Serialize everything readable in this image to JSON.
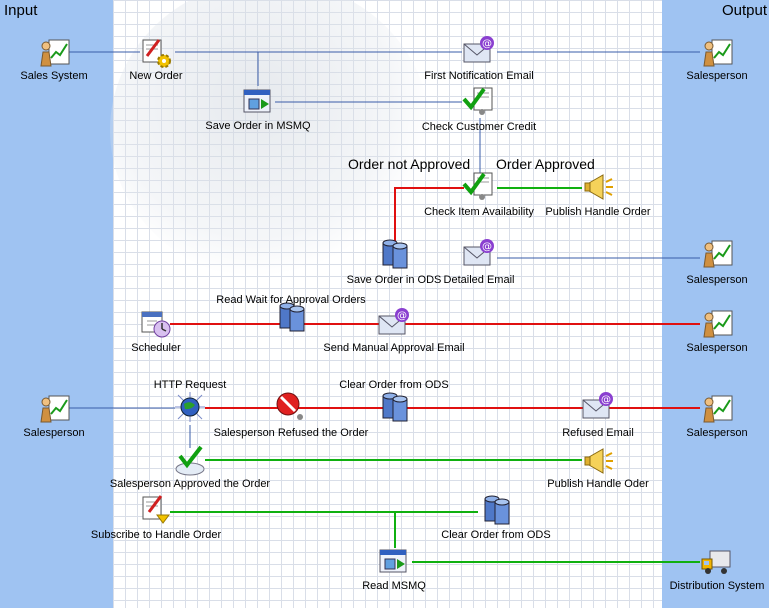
{
  "lanes": {
    "input": "Input",
    "output": "Output"
  },
  "colors": {
    "lane": "#9fc3f2",
    "line": "#3a5ca8",
    "red": "#e01010",
    "green": "#10b010"
  },
  "branch_labels": {
    "not_approved": "Order not Approved",
    "approved": "Order Approved"
  },
  "nodes": {
    "sales_system": {
      "label": "Sales System",
      "icon": "person-chart-icon"
    },
    "new_order": {
      "label": "New Order",
      "icon": "document-gear-icon"
    },
    "first_email": {
      "label": "First Notification Email",
      "icon": "email-icon"
    },
    "salesperson_1": {
      "label": "Salesperson",
      "icon": "person-chart-icon"
    },
    "save_msmq": {
      "label": "Save Order in MSMQ",
      "icon": "queue-icon"
    },
    "check_credit": {
      "label": "Check Customer Credit",
      "icon": "check-document-icon"
    },
    "check_item": {
      "label": "Check Item Availability",
      "icon": "check-document-icon"
    },
    "publish_1": {
      "label": "Publish Handle Order",
      "icon": "megaphone-icon"
    },
    "save_ods": {
      "label": "Save Order in ODS",
      "icon": "database-icon"
    },
    "detailed_email": {
      "label": "Detailed Email",
      "icon": "email-icon"
    },
    "salesperson_2": {
      "label": "Salesperson",
      "icon": "person-chart-icon"
    },
    "scheduler": {
      "label": "Scheduler",
      "icon": "calendar-clock-icon"
    },
    "read_wait": {
      "label": "Read Wait for Approval Orders",
      "icon": "database-icon"
    },
    "manual_email": {
      "label": "Send Manual Approval Email",
      "icon": "email-icon"
    },
    "salesperson_3": {
      "label": "Salesperson",
      "icon": "person-chart-icon"
    },
    "salesperson_in": {
      "label": "Salesperson",
      "icon": "person-chart-icon"
    },
    "http_request": {
      "label": "HTTP Request",
      "icon": "globe-request-icon"
    },
    "refused": {
      "label": "Salesperson Refused the Order",
      "icon": "stop-sign-icon"
    },
    "clear_ods_1": {
      "label": "Clear Order from ODS",
      "icon": "database-icon"
    },
    "refused_email": {
      "label": "Refused Email",
      "icon": "email-icon"
    },
    "salesperson_4": {
      "label": "Salesperson",
      "icon": "person-chart-icon"
    },
    "approved": {
      "label": "Salesperson Approved the Order",
      "icon": "approve-check-icon"
    },
    "publish_2": {
      "label": "Publish Handle Oder",
      "icon": "megaphone-icon"
    },
    "subscribe": {
      "label": "Subscribe to Handle Order",
      "icon": "document-pen-icon"
    },
    "clear_ods_2": {
      "label": "Clear Order from ODS",
      "icon": "database-icon"
    },
    "read_msmq": {
      "label": "Read MSMQ",
      "icon": "queue-icon"
    },
    "distribution": {
      "label": "Distribution System",
      "icon": "truck-icon"
    }
  }
}
